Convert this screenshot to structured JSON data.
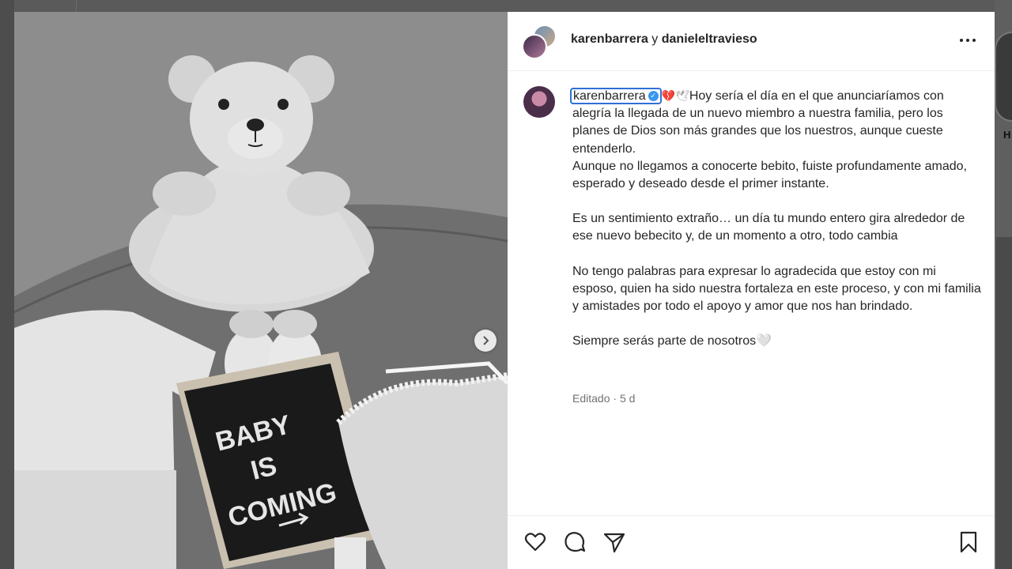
{
  "background": {
    "right_label": "H"
  },
  "post": {
    "header": {
      "user1": "karenbarrera",
      "conjunction": "y",
      "user2": "danieleltravieso"
    },
    "letterboard": {
      "line1": "BABY",
      "line2": "IS",
      "line3": "COMING"
    },
    "caption": {
      "username": "karenbarrera",
      "line0": "Hoy sería el día en el que anunciaríamos con alegría la llegada de un nuevo miembro a nuestra familia, pero los planes de Dios son más grandes que los nuestros, aunque cueste entenderlo.",
      "line1": "Aunque no llegamos a conocerte bebito, fuiste profundamente amado, esperado y deseado desde el primer instante.",
      "para2": "Es un sentimiento extraño… un día tu mundo entero gira alrededor de ese nuevo bebecito y, de un momento a otro, todo cambia",
      "para3": "No tengo palabras para expresar lo agradecida que estoy con mi esposo, quien ha sido nuestra fortaleza en este proceso, y con mi familia y amistades por todo el apoyo y amor que nos han brindado.",
      "para4": "Siempre serás parte de nosotros",
      "para4_emoji": "🤍"
    },
    "meta": {
      "edited": "Editado",
      "separator": "·",
      "time": "5 d"
    },
    "icons": {
      "like": "heart-outline-icon",
      "comment": "comment-bubble-icon",
      "share": "paper-plane-icon",
      "save": "bookmark-icon",
      "more": "ellipsis-icon",
      "next": "chevron-right-icon"
    }
  },
  "colors": {
    "verified": "#3897f0",
    "text": "#262626",
    "muted": "#737373",
    "focus": "#2f6fd6"
  }
}
